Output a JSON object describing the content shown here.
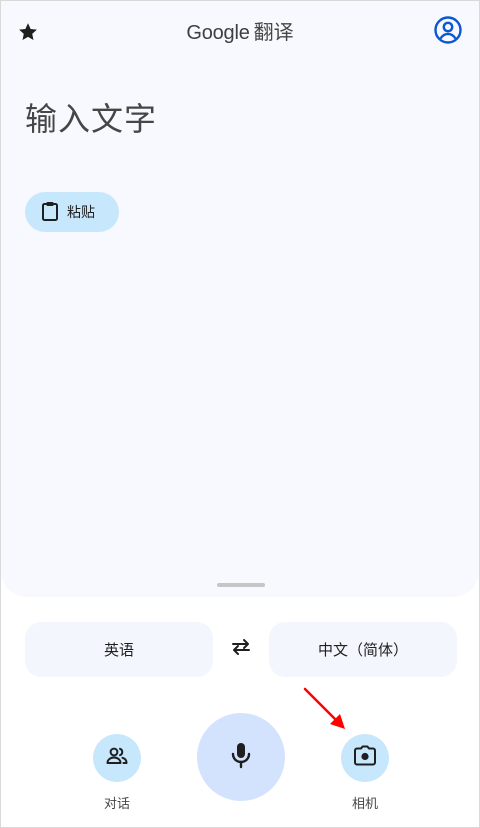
{
  "header": {
    "brand": "Google",
    "product": "翻译",
    "star_icon": "star-icon",
    "account_icon": "account-circle-icon"
  },
  "input": {
    "placeholder": "输入文字"
  },
  "paste": {
    "label": "粘贴",
    "icon": "clipboard-icon"
  },
  "languages": {
    "source": "英语",
    "target": "中文（简体）",
    "swap_icon": "swap-arrows-icon"
  },
  "actions": {
    "conversation_label": "对话",
    "conversation_icon": "people-icon",
    "mic_icon": "mic-icon",
    "camera_label": "相机",
    "camera_icon": "camera-icon"
  },
  "colors": {
    "background_card": "#f7f9fe",
    "chip_blue": "#c7e7fc",
    "mic_blue": "#d3e3fd",
    "account_blue": "#0b57d0",
    "annotation_red": "#ff0000"
  }
}
